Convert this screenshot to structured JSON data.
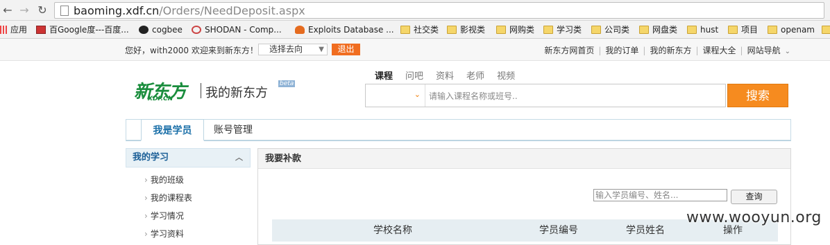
{
  "browser": {
    "url_host": "baoming.xdf.cn",
    "url_path": "/Orders/NeedDeposit.aspx",
    "bookmarks": [
      {
        "label": "应用",
        "icon": "apps-icon"
      },
      {
        "label": "百Google度---百度...",
        "icon": "site-icon"
      },
      {
        "label": "cogbee",
        "icon": "github-icon"
      },
      {
        "label": "SHODAN - Comp...",
        "icon": "shodan-icon"
      },
      {
        "label": "Exploits Database ...",
        "icon": "exploitdb-icon"
      },
      {
        "label": "社交类",
        "icon": "folder-icon"
      },
      {
        "label": "影视类",
        "icon": "folder-icon"
      },
      {
        "label": "网购类",
        "icon": "folder-icon"
      },
      {
        "label": "学习类",
        "icon": "folder-icon"
      },
      {
        "label": "公司类",
        "icon": "folder-icon"
      },
      {
        "label": "网盘类",
        "icon": "folder-icon"
      },
      {
        "label": "hust",
        "icon": "folder-icon"
      },
      {
        "label": "项目",
        "icon": "folder-icon"
      },
      {
        "label": "openam",
        "icon": "folder-icon"
      }
    ]
  },
  "topbar": {
    "greeting": "您好，with2000 欢迎来到新东方！",
    "select_value": "选择去向",
    "logout": "退出",
    "links": [
      "新东方网首页",
      "我的订单",
      "我的新东方",
      "课程大全",
      "网站导航"
    ]
  },
  "header": {
    "logo_text": "新东方",
    "logo_sub": "XDF.CN",
    "title": "我的新东方",
    "beta": "beta",
    "search_tabs": [
      "课程",
      "问吧",
      "资料",
      "老师",
      "视频"
    ],
    "search_placeholder": "请输入课程名称或班号..",
    "search_button": "搜索"
  },
  "main_tabs": [
    "我是学员",
    "账号管理"
  ],
  "sidebar": {
    "section": "我的学习",
    "items": [
      "我的班级",
      "我的课程表",
      "学习情况",
      "学习资料"
    ]
  },
  "panel": {
    "title": "我要补款",
    "query_placeholder": "输入学员编号、姓名...",
    "query_button": "查询",
    "columns": [
      "学校名称",
      "学员编号",
      "学员姓名",
      "操作"
    ]
  },
  "watermark": "www.wooyun.org",
  "colors": {
    "brand_green": "#1a8d3d",
    "accent_orange": "#f68b1f",
    "link_blue": "#1a6fa8"
  }
}
